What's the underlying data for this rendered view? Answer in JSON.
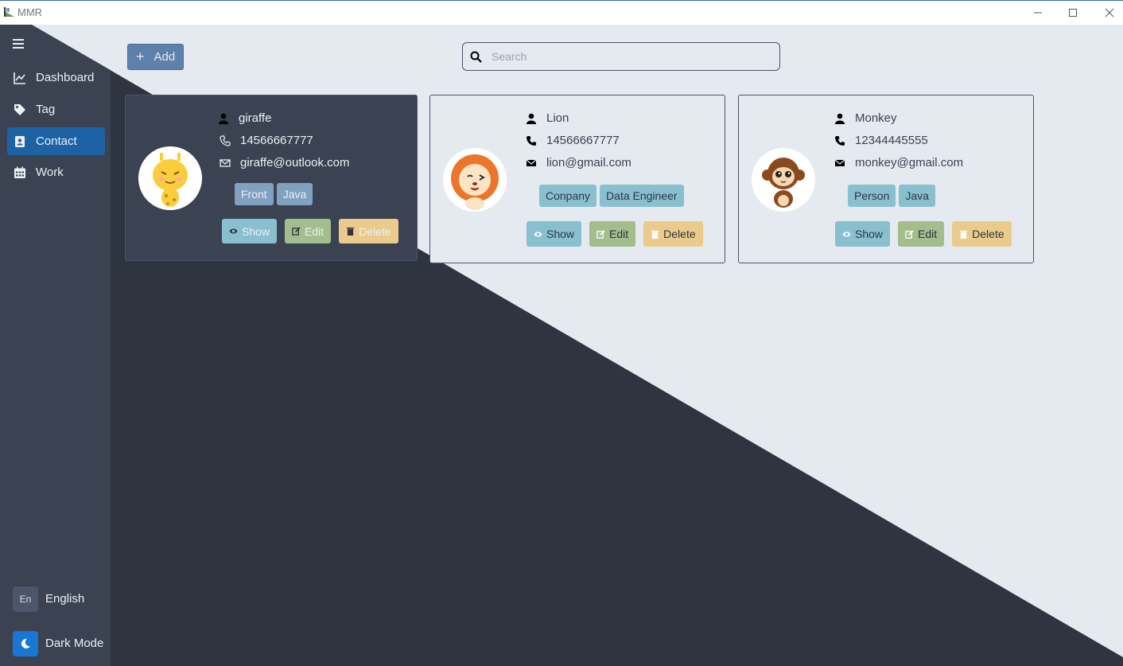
{
  "window": {
    "title": "MMR",
    "minimize_icon": "minimize-icon",
    "maximize_icon": "maximize-icon",
    "close_icon": "close-icon"
  },
  "sidebar": {
    "menu_icon": "menu-icon",
    "items": [
      {
        "label": "Dashboard",
        "icon": "chart-line-icon",
        "active": false
      },
      {
        "label": "Tag",
        "icon": "tag-icon",
        "active": false
      },
      {
        "label": "Contact",
        "icon": "contact-card-icon",
        "active": true
      },
      {
        "label": "Work",
        "icon": "calendar-icon",
        "active": false
      }
    ],
    "language": {
      "code": "En",
      "label": "English"
    },
    "dark_mode": {
      "label": "Dark Mode",
      "icon": "moon-icon"
    }
  },
  "toolbar": {
    "add_label": "Add",
    "search_placeholder": "Search"
  },
  "contacts": [
    {
      "name": "giraffe",
      "phone": "14566667777",
      "email": "giraffe@outlook.com",
      "tags": [
        "Front",
        "Java"
      ]
    },
    {
      "name": "Lion",
      "phone": "14566667777",
      "email": "lion@gmail.com",
      "tags": [
        "Conpany",
        "Data Engineer"
      ]
    },
    {
      "name": "Monkey",
      "phone": "12344445555",
      "email": "monkey@gmail.com",
      "tags": [
        "Person",
        "Java"
      ]
    }
  ],
  "card_actions": {
    "show": "Show",
    "edit": "Edit",
    "delete": "Delete"
  },
  "colors": {
    "accent": "#1e62a6",
    "dark_bg": "#2e3440",
    "light_bg": "#e5e9f0",
    "show": "#88c0d0",
    "edit": "#a3be8c",
    "delete": "#ebcb8b",
    "add": "#5e81ac"
  }
}
